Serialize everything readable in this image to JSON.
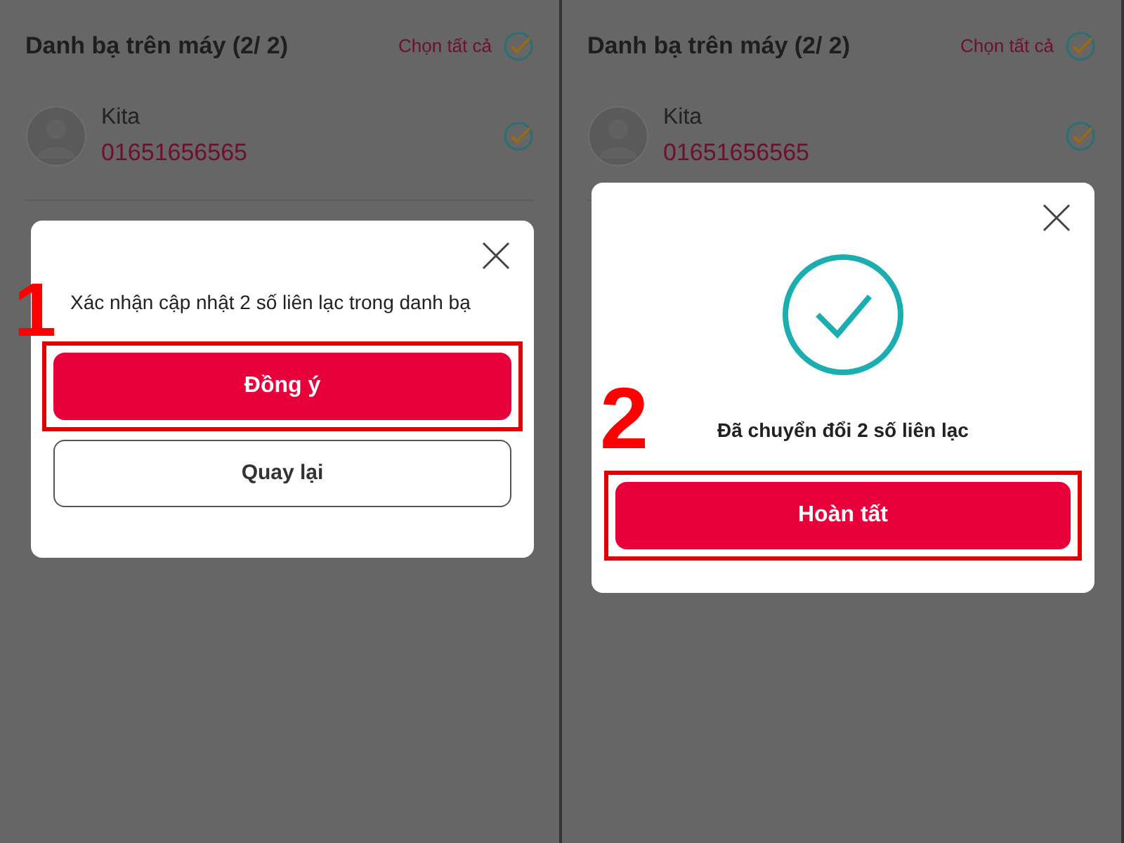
{
  "panels": [
    {
      "title": "Danh bạ trên máy (2/ 2)",
      "select_all": "Chọn tất cả",
      "all_checked": true,
      "contacts": [
        {
          "name": "Kita",
          "phone": "01651656565",
          "checked": true
        }
      ],
      "dialog": {
        "kind": "confirm",
        "message": "Xác nhận cập nhật 2 số liên lạc trong danh bạ",
        "buttons": [
          {
            "label": "Đồng ý",
            "kind": "primary",
            "highlighted": true
          },
          {
            "label": "Quay lại",
            "kind": "secondary",
            "highlighted": false
          }
        ]
      },
      "step": "1"
    },
    {
      "title": "Danh bạ trên máy (2/ 2)",
      "select_all": "Chọn tất cả",
      "all_checked": true,
      "contacts": [
        {
          "name": "Kita",
          "phone": "01651656565",
          "checked": true
        }
      ],
      "dialog": {
        "kind": "done",
        "message": "Đã chuyển đổi 2 số liên lạc",
        "buttons": [
          {
            "label": "Hoàn tất",
            "kind": "primary",
            "highlighted": true
          }
        ]
      },
      "step": "2"
    }
  ]
}
